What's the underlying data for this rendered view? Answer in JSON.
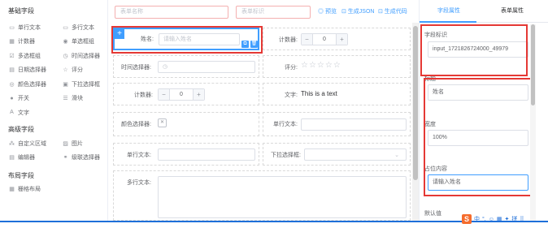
{
  "palette": {
    "basic_title": "基础字段",
    "basic_items": [
      {
        "label": "单行文本",
        "icon": "input-icon",
        "glyph": "▭"
      },
      {
        "label": "多行文本",
        "icon": "textarea-icon",
        "glyph": "▭"
      },
      {
        "label": "计数器",
        "icon": "counter-icon",
        "glyph": "▦"
      },
      {
        "label": "单选框组",
        "icon": "radio-icon",
        "glyph": "◉"
      },
      {
        "label": "多选框组",
        "icon": "checkbox-icon",
        "glyph": "☑"
      },
      {
        "label": "时间选择器",
        "icon": "clock-icon",
        "glyph": "◷"
      },
      {
        "label": "日期选择器",
        "icon": "calendar-icon",
        "glyph": "▤"
      },
      {
        "label": "评分",
        "icon": "star-icon",
        "glyph": "☆"
      },
      {
        "label": "颜色选择器",
        "icon": "palette-icon",
        "glyph": "◎"
      },
      {
        "label": "下拉选择框",
        "icon": "select-icon",
        "glyph": "▣"
      },
      {
        "label": "开关",
        "icon": "switch-icon",
        "glyph": "●"
      },
      {
        "label": "滑块",
        "icon": "slider-icon",
        "glyph": "☰"
      },
      {
        "label": "文字",
        "icon": "text-icon",
        "glyph": "A"
      }
    ],
    "advanced_title": "高级字段",
    "advanced_items": [
      {
        "label": "自定义区域",
        "icon": "custom-area-icon",
        "glyph": "⁂"
      },
      {
        "label": "图片",
        "icon": "image-icon",
        "glyph": "▨"
      },
      {
        "label": "编辑器",
        "icon": "editor-icon",
        "glyph": "▤"
      },
      {
        "label": "级联选择器",
        "icon": "cascader-icon",
        "glyph": "⚭"
      }
    ],
    "layout_title": "布局字段",
    "layout_items": [
      {
        "label": "栅格布局",
        "icon": "grid-icon",
        "glyph": "▦"
      }
    ]
  },
  "toolbar": {
    "form_name_placeholder": "表单名称",
    "form_id_placeholder": "表单标识",
    "preview": "◎ 预览",
    "gen_json": "⊡ 生成JSON",
    "gen_code": "⊡ 生成代码"
  },
  "canvas": {
    "name_label": "姓名:",
    "name_placeholder": "请输入姓名",
    "counter_label": "计数器:",
    "counter_value": "0",
    "time_label": "时间选择器:",
    "time_icon": "◷",
    "rating_label": "评分:",
    "rating_stars": "☆☆☆☆☆",
    "counter2_label": "计数器:",
    "counter2_value": "0",
    "text_label": "文字:",
    "text_value": "This is a text",
    "color_label": "颜色选择器:",
    "single_text_label": "单行文本:",
    "single_text2_label": "单行文本:",
    "dropdown_label": "下拉选择框:",
    "multi_text_label": "多行文本:",
    "minus": "−",
    "plus": "+",
    "add": "+",
    "copy_glyph": "⧉",
    "delete_glyph": "🗑",
    "chevron": "⌄",
    "swatch_glyph": "✕"
  },
  "right_panel": {
    "tab_field": "字段属性",
    "tab_form": "表单属性",
    "field_id_label": "字段标识",
    "field_id_value": "input_1721826724000_49979",
    "title_label": "标题",
    "title_value": "姓名",
    "width_label": "宽度",
    "width_value": "100%",
    "placeholder_label": "占位内容",
    "placeholder_value": "请输入姓名",
    "default_label": "默认值"
  },
  "ime": {
    "logo": "S",
    "items": [
      "中",
      "°,",
      "☺",
      "▦",
      "✦",
      "拼",
      "⠿"
    ]
  },
  "colors": {
    "accent": "#409eff",
    "annotation_red": "#e53935",
    "taskbar_blue": "#1e6fd9"
  }
}
